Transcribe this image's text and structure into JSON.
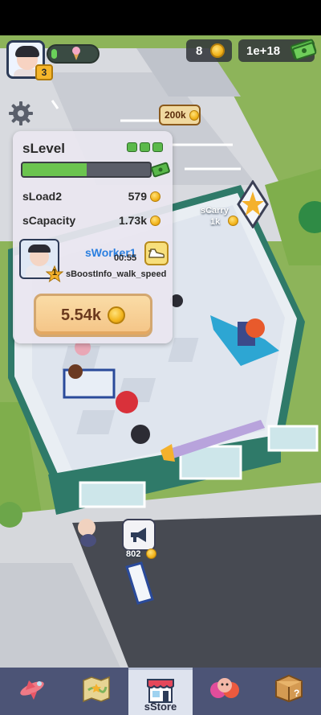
{
  "hud": {
    "player_level": "3",
    "xp_progress": 0.12,
    "coins": "8",
    "cash": "1e+18"
  },
  "world": {
    "price_tag": "200k",
    "carry_label": "sCarry",
    "carry_value": "1k",
    "megaphone_cost": "802"
  },
  "panel": {
    "title": "sLevel",
    "level_dots": 3,
    "level_progress": 0.5,
    "load_label": "sLoad2",
    "load_value": "579",
    "capacity_label": "sCapacity",
    "capacity_value": "1.73k",
    "worker_name": "sWorker1",
    "worker_level": "1",
    "worker_timer": "00:55",
    "boost_text": "sBoostInfo_walk_speed",
    "buy_label": "5.54k"
  },
  "nav": [
    {
      "label": "",
      "icon": "airplane-icon"
    },
    {
      "label": "",
      "icon": "map-icon"
    },
    {
      "label": "sStore",
      "icon": "store-icon"
    },
    {
      "label": "",
      "icon": "characters-icon"
    },
    {
      "label": "",
      "icon": "mystery-box-icon"
    }
  ],
  "colors": {
    "panel_bg": "#e9e6f0",
    "progress_green": "#6bc44f",
    "worker_name_blue": "#2a7fe0",
    "buy_button": "#f4c486",
    "nav_bg": "#4c5476"
  }
}
